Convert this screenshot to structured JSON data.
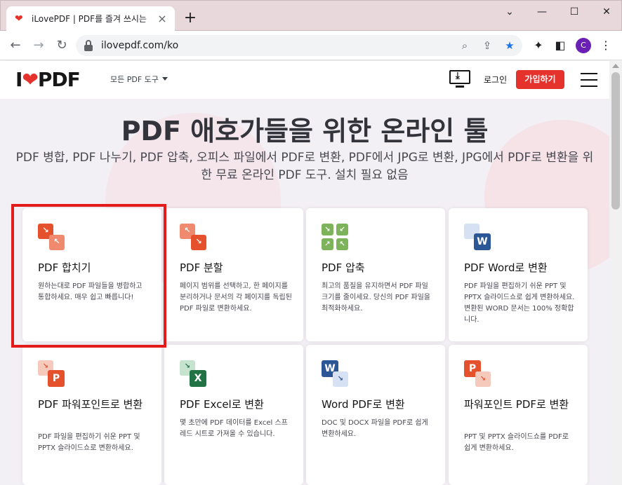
{
  "browser": {
    "tab_title": "iLovePDF | PDF를 즐겨 쓰시는 사",
    "tab_close": "×",
    "new_tab": "+",
    "url": "ilovepdf.com/ko",
    "profile_initial": "C",
    "window_minimize": "—",
    "window_maximize": "☐",
    "window_close": "✕"
  },
  "header": {
    "logo_i": "I",
    "logo_pdf": "PDF",
    "tools_menu": "모든 PDF 도구",
    "login": "로그인",
    "signup": "가입하기"
  },
  "hero": {
    "title": "PDF 애호가들을 위한 온라인 툴",
    "subtitle": "PDF 병합, PDF 나누기, PDF 압축, 오피스 파일에서 PDF로 변환, PDF에서 JPG로 변환, JPG에서 PDF로 변환을 위한 무료 온라인 PDF 도구. 설치 필요 없음"
  },
  "tools": [
    {
      "title": "PDF 합치기",
      "desc": "원하는대로 PDF 파일들을 병합하고 통합하세요. 매우 쉽고 빠릅니다!",
      "icon": "merge-icon",
      "color": "#e5512d"
    },
    {
      "title": "PDF 분할",
      "desc": "페이지 범위를 선택하고, 한 페이지를 분리하거나 문서의 각 페이지를 독립된 PDF 파일로 변환하세요.",
      "icon": "split-icon",
      "color": "#e5512d"
    },
    {
      "title": "PDF 압축",
      "desc": "최고의 품질을 유지하면서 PDF 파일 크기를 줄이세요. 당신의 PDF 파일을 최적화하세요.",
      "icon": "compress-icon",
      "color": "#6aa84f"
    },
    {
      "title": "PDF Word로 변환",
      "desc": "PDF 파일을 편집하기 쉬운 PPT 및 PPTX 슬라이드쇼로 쉽게 변환하세요. 변환된 WORD 문서는 100% 정확합니다.",
      "icon": "word-icon",
      "color": "#2b5797"
    },
    {
      "title": "PDF 파워포인트로 변환",
      "desc": "PDF 파일을 편집하기 쉬운 PPT 및 PPTX 슬라이드쇼로 변환하세요.",
      "icon": "powerpoint-icon",
      "color": "#e5512d"
    },
    {
      "title": "PDF Excel로 변환",
      "desc": "몇 초만에 PDF 데이터를 Excel 스프레드 시트로 가져올 수 있습니다.",
      "icon": "excel-icon",
      "color": "#217346"
    },
    {
      "title": "Word PDF로 변환",
      "desc": "DOC 및 DOCX 파일을 PDF로 쉽게 변환하세요.",
      "icon": "word-to-pdf-icon",
      "color": "#2b5797"
    },
    {
      "title": "파워포인트 PDF로 변환",
      "desc": "PPT 및 PPTX 슬라이드쇼를 PDF로 쉽게 변환하세요.",
      "icon": "powerpoint-to-pdf-icon",
      "color": "#e5512d"
    }
  ],
  "icon_letters": {
    "word": "W",
    "powerpoint": "P",
    "excel": "X"
  },
  "colors": {
    "brand_red": "#e5322d",
    "highlight_border": "#e31b1b"
  }
}
